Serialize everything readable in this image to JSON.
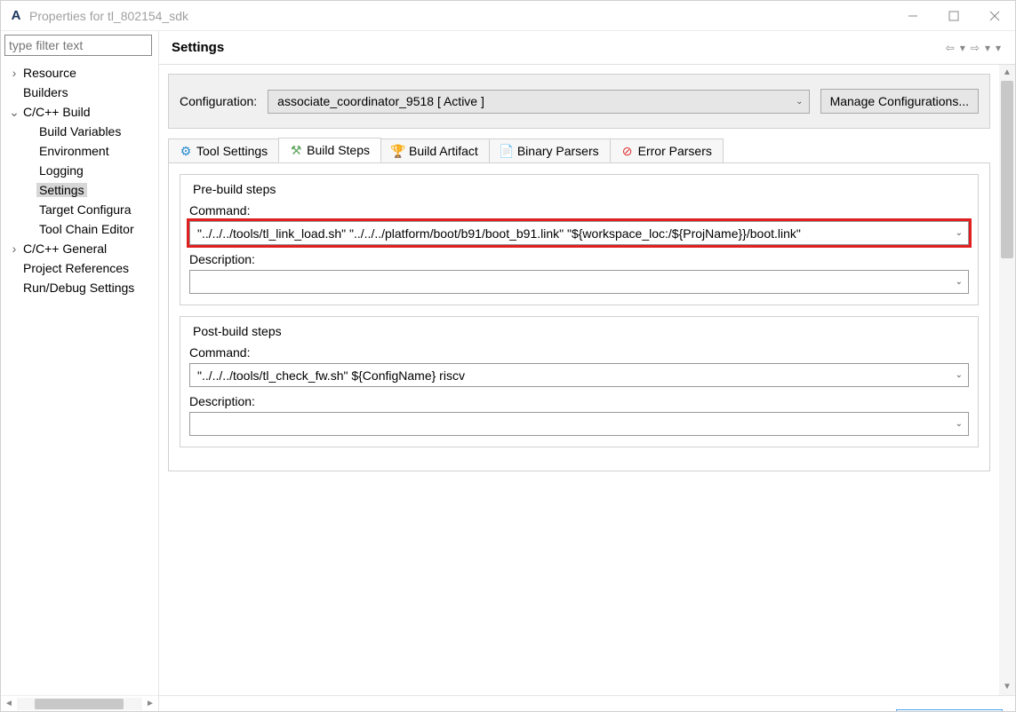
{
  "window": {
    "title": "Properties for tl_802154_sdk"
  },
  "sidebar": {
    "filter_placeholder": "type filter text",
    "items": [
      {
        "label": "Resource",
        "level": 1,
        "expander": "›"
      },
      {
        "label": "Builders",
        "level": 1,
        "expander": ""
      },
      {
        "label": "C/C++ Build",
        "level": 1,
        "expander": "⌄"
      },
      {
        "label": "Build Variables",
        "level": 2,
        "expander": ""
      },
      {
        "label": "Environment",
        "level": 2,
        "expander": ""
      },
      {
        "label": "Logging",
        "level": 2,
        "expander": ""
      },
      {
        "label": "Settings",
        "level": 2,
        "expander": "",
        "selected": true
      },
      {
        "label": "Target Configura",
        "level": 2,
        "expander": ""
      },
      {
        "label": "Tool Chain Editor",
        "level": 2,
        "expander": ""
      },
      {
        "label": "C/C++ General",
        "level": 1,
        "expander": "›"
      },
      {
        "label": "Project References",
        "level": 1,
        "expander": ""
      },
      {
        "label": "Run/Debug Settings",
        "level": 1,
        "expander": ""
      }
    ]
  },
  "content": {
    "heading": "Settings",
    "configuration": {
      "label": "Configuration:",
      "value_display": "associate_coordinator_9518  [ Active ]",
      "manage_btn": "Manage Configurations..."
    },
    "tabs": [
      {
        "label": "Tool Settings",
        "icon_color": "#2288cc"
      },
      {
        "label": "Build Steps",
        "icon_color": "#5aa35a",
        "active": true
      },
      {
        "label": "Build Artifact",
        "icon_color": "#e0a030"
      },
      {
        "label": "Binary Parsers",
        "icon_color": "#3070c0"
      },
      {
        "label": "Error Parsers",
        "icon_color": "#e03030"
      }
    ],
    "pre_build": {
      "legend": "Pre-build steps",
      "command_label": "Command:",
      "command_value": "\"../../../tools/tl_link_load.sh\" \"../../../platform/boot/b91/boot_b91.link\" \"${workspace_loc:/${ProjName}}/boot.link\"",
      "description_label": "Description:",
      "description_value": ""
    },
    "post_build": {
      "legend": "Post-build steps",
      "command_label": "Command:",
      "command_value": "\"../../../tools/tl_check_fw.sh\" ${ConfigName} riscv",
      "description_label": "Description:",
      "description_value": ""
    }
  }
}
